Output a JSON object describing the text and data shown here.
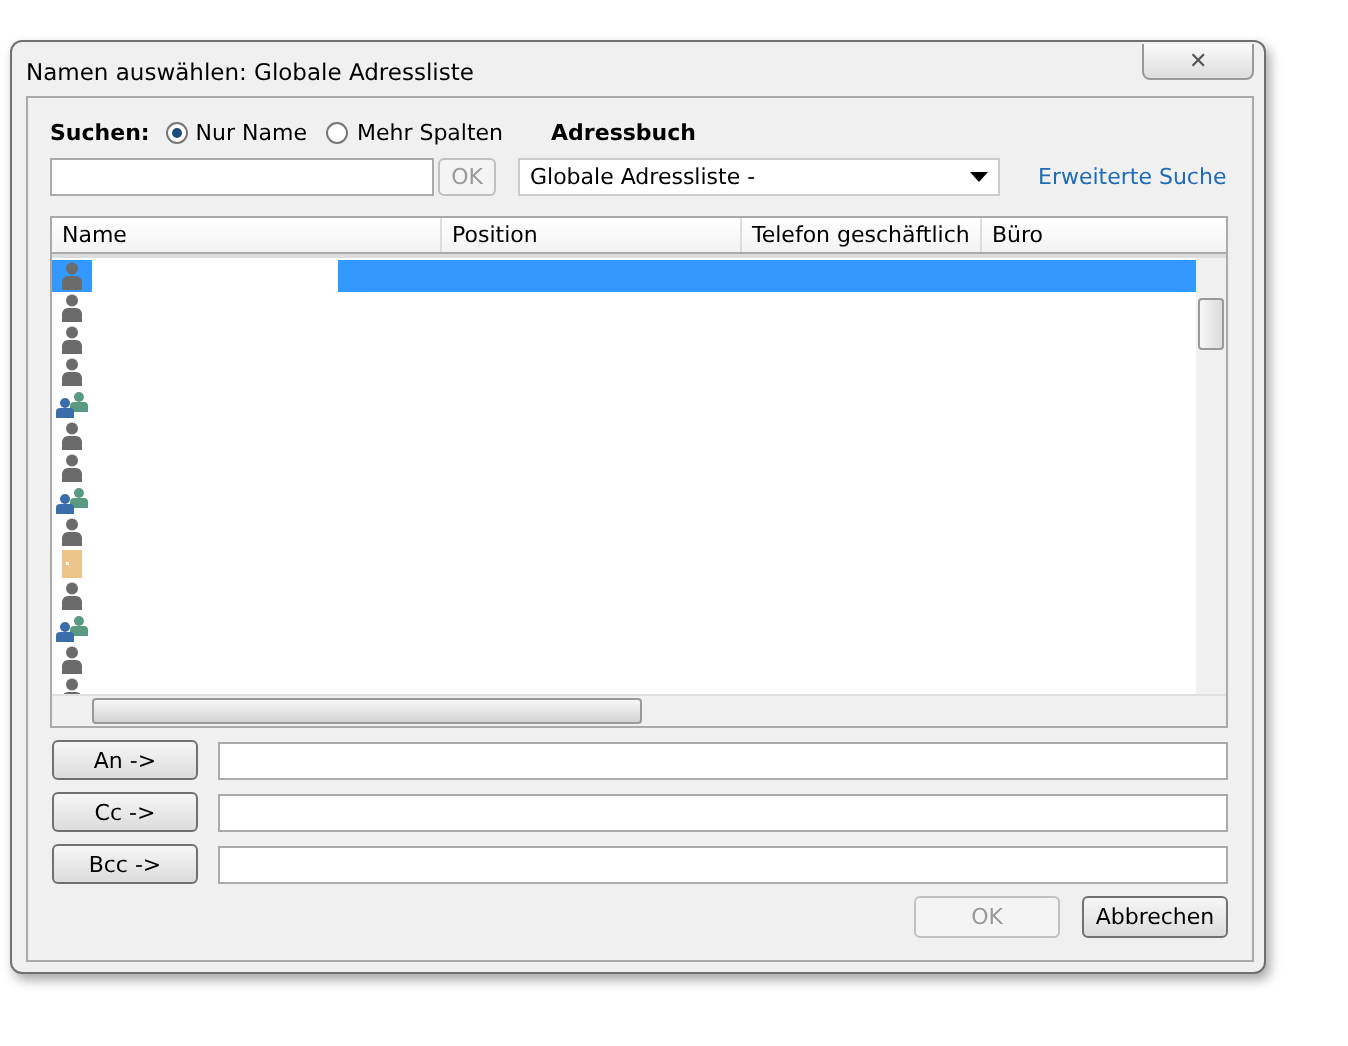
{
  "window": {
    "title": "Namen auswählen: Globale Adressliste",
    "close": "✕"
  },
  "search": {
    "label": "Suchen:",
    "options": [
      {
        "label": "Nur Name",
        "selected": true
      },
      {
        "label": "Mehr Spalten",
        "selected": false
      }
    ],
    "ok": {
      "label": "OK",
      "disabled": true
    }
  },
  "address_book": {
    "label": "Adressbuch",
    "value": "Globale Adressliste -"
  },
  "advanced_search": "Erweiterte Suche",
  "columns": [
    "Name",
    "Position",
    "Telefon geschäftlich",
    "Büro"
  ],
  "rows": [
    {
      "kind": "user",
      "selected": true
    },
    {
      "kind": "user",
      "selected": false
    },
    {
      "kind": "user",
      "selected": false
    },
    {
      "kind": "user",
      "selected": false
    },
    {
      "kind": "group",
      "selected": false
    },
    {
      "kind": "user",
      "selected": false
    },
    {
      "kind": "user",
      "selected": false
    },
    {
      "kind": "group",
      "selected": false
    },
    {
      "kind": "user",
      "selected": false
    },
    {
      "kind": "folder",
      "selected": false
    },
    {
      "kind": "user",
      "selected": false
    },
    {
      "kind": "group",
      "selected": false
    },
    {
      "kind": "user",
      "selected": false
    },
    {
      "kind": "user",
      "selected": false
    }
  ],
  "recipients": [
    {
      "label": "An ->"
    },
    {
      "label": "Cc ->"
    },
    {
      "label": "Bcc ->"
    }
  ],
  "buttons": [
    {
      "label": "OK",
      "disabled": true
    },
    {
      "label": "Abbrechen",
      "disabled": false
    }
  ]
}
